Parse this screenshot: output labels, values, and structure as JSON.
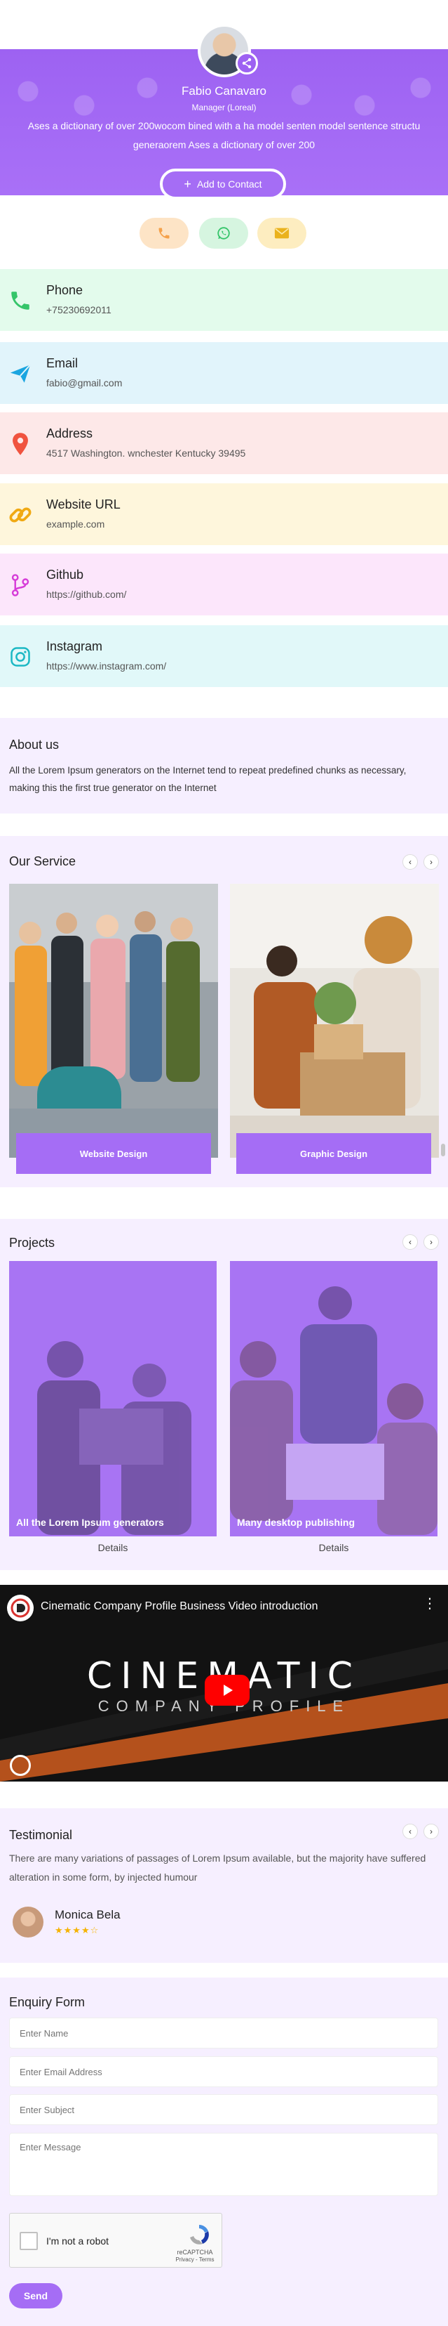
{
  "profile": {
    "name": "Fabio Canavaro",
    "role": "Manager (Loreal)",
    "bio": "Ases a dictionary of over 200wocom bined with a ha model senten model sentence structu generaorem Ases a dictionary of over 200",
    "add_contact_label": "Add to Contact"
  },
  "quick_actions": [
    {
      "icon": "phone-icon",
      "color": "#f5a14a"
    },
    {
      "icon": "whatsapp-icon",
      "color": "#35c56a"
    },
    {
      "icon": "mail-icon",
      "color": "#eab21d"
    }
  ],
  "contacts": [
    {
      "label": "Phone",
      "value": "+75230692011",
      "bg": "#e3fbec",
      "icon": "phone-icon",
      "color": "#35c56a"
    },
    {
      "label": "Email",
      "value": "fabio@gmail.com",
      "bg": "#e1f4fb",
      "icon": "send-icon",
      "color": "#1aa5e0"
    },
    {
      "label": "Address",
      "value": "4517 Washington. wnchester Kentucky 39495",
      "bg": "#fde8e8",
      "icon": "location-pin-icon",
      "color": "#f0533f"
    },
    {
      "label": "Website URL",
      "value": "example.com",
      "bg": "#fef6dc",
      "icon": "link-icon",
      "color": "#f0a913"
    },
    {
      "label": "Github",
      "value": "https://github.com/",
      "bg": "#fce6fb",
      "icon": "github-branch-icon",
      "color": "#d63bd8"
    },
    {
      "label": "Instagram",
      "value": "https://www.instagram.com/",
      "bg": "#e1f8f9",
      "icon": "instagram-icon",
      "color": "#1bb8c4"
    }
  ],
  "about": {
    "title": "About us",
    "text": "All the Lorem Ipsum generators on the Internet tend to repeat predefined chunks as necessary, making this the first true generator on the Internet"
  },
  "services": {
    "title": "Our Service",
    "items": [
      {
        "label": "Website Design"
      },
      {
        "label": "Graphic Design"
      }
    ]
  },
  "projects": {
    "title": "Projects",
    "items": [
      {
        "caption": "All the Lorem Ipsum generators",
        "details": "Details"
      },
      {
        "caption": "Many desktop publishing",
        "details": "Details"
      }
    ]
  },
  "video": {
    "title": "Cinematic Company Profile Business Video introduction",
    "big_text": "CINEMATIC",
    "sub_text": "COMPANY PROFILE"
  },
  "testimonial": {
    "title": "Testimonial",
    "text": "There are many variations of passages of Lorem Ipsum available, but the majority have suffered alteration in some form, by injected humour",
    "name": "Monica Bela",
    "rating": 4.5
  },
  "enquiry": {
    "title": "Enquiry Form",
    "name_placeholder": "Enter Name",
    "email_placeholder": "Enter Email Address",
    "subject_placeholder": "Enter Subject",
    "message_placeholder": "Enter Message",
    "captcha_label": "I'm not a robot",
    "captcha_brand": "reCAPTCHA",
    "captcha_terms": "Privacy - Terms",
    "send_label": "Send"
  }
}
